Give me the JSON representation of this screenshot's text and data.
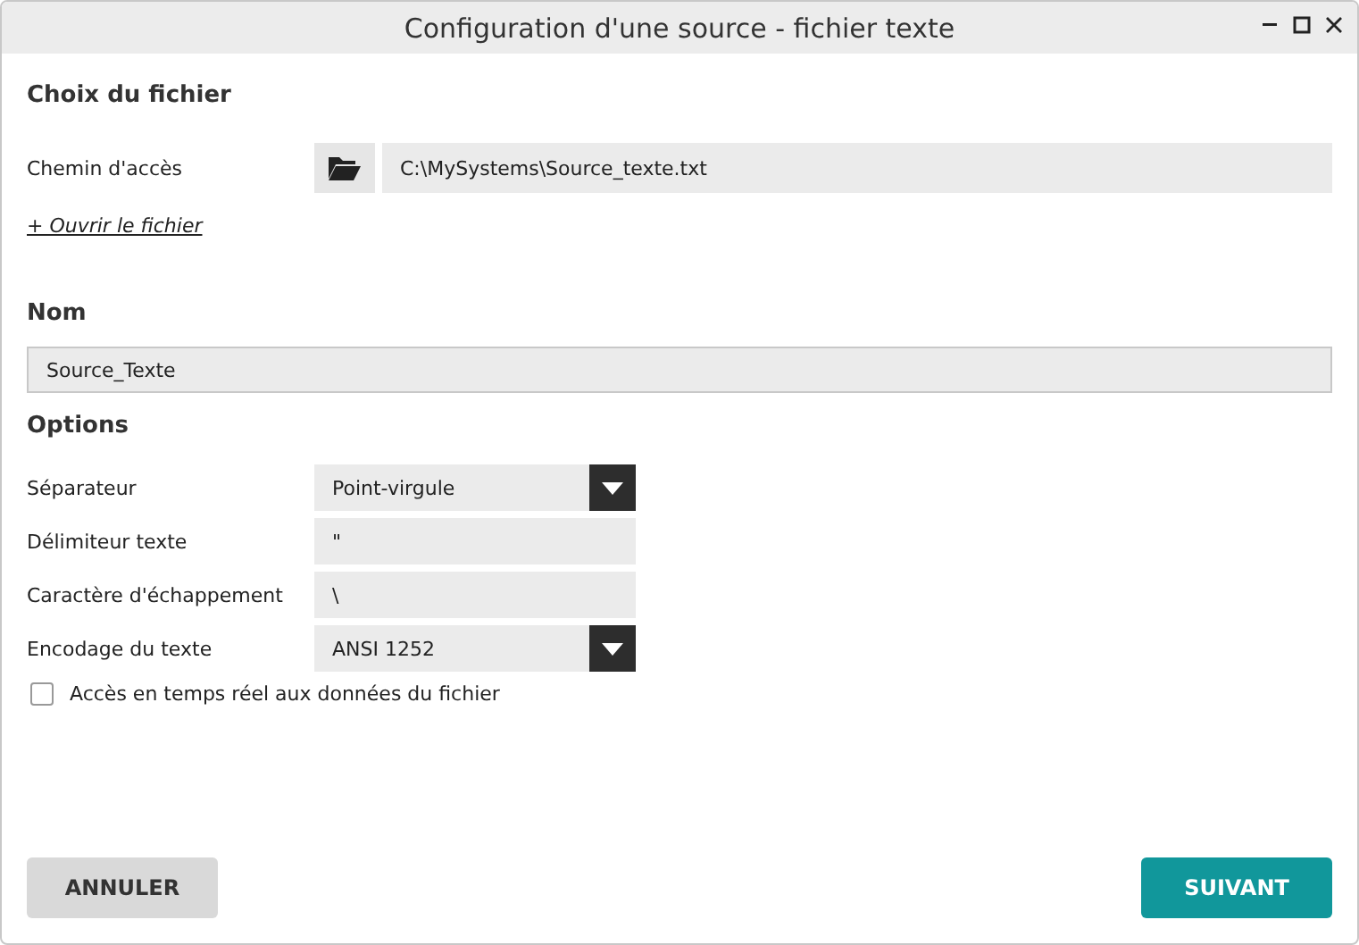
{
  "window": {
    "title": "Configuration d'une source - fichier texte"
  },
  "file_section": {
    "heading": "Choix du fichier",
    "path_label": "Chemin d'accès",
    "path_value": "C:\\MySystems\\Source_texte.txt",
    "open_link": "+ Ouvrir le fichier"
  },
  "name_section": {
    "heading": "Nom",
    "value": "Source_Texte"
  },
  "options": {
    "heading": "Options",
    "rows": [
      {
        "kind": "dropdown",
        "label": "Séparateur",
        "value": "Point-virgule"
      },
      {
        "kind": "text",
        "label": "Délimiteur texte",
        "value": "\""
      },
      {
        "kind": "text",
        "label": "Caractère d'échappement",
        "value": "\\"
      },
      {
        "kind": "dropdown",
        "label": "Encodage du texte",
        "value": "ANSI 1252"
      }
    ],
    "realtime": {
      "label": "Accès en temps réel aux données du fichier",
      "checked": false
    }
  },
  "buttons": {
    "cancel": "ANNULER",
    "next": "SUIVANT"
  }
}
